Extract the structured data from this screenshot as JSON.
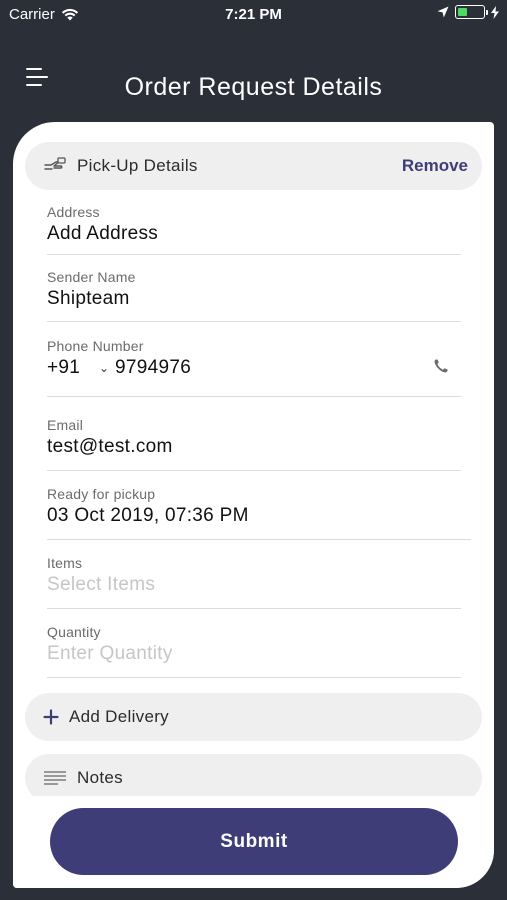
{
  "status_bar": {
    "carrier": "Carrier",
    "time": "7:21 PM"
  },
  "header": {
    "title": "Order Request Details"
  },
  "pickup": {
    "title": "Pick-Up Details",
    "remove_label": "Remove",
    "fields": {
      "address": {
        "label": "Address",
        "value": "Add Address"
      },
      "sender": {
        "label": "Sender Name",
        "value": "Shipteam"
      },
      "phone": {
        "label": "Phone Number",
        "code": "+91",
        "number": "9794976"
      },
      "email": {
        "label": "Email",
        "value": "test@test.com"
      },
      "ready": {
        "label": "Ready for pickup",
        "value": "03 Oct 2019, 07:36 PM"
      },
      "items": {
        "label": "Items",
        "placeholder": "Select Items"
      },
      "quantity": {
        "label": "Quantity",
        "placeholder": "Enter Quantity"
      }
    }
  },
  "add_delivery": {
    "label": "Add Delivery"
  },
  "notes": {
    "label": "Notes"
  },
  "submit": {
    "label": "Submit"
  },
  "colors": {
    "accent": "#3f3d78",
    "header_bg": "#2b2f38",
    "battery": "#4cd964"
  },
  "icons": {
    "wifi": "wifi-icon",
    "location": "location-arrow-icon",
    "battery": "battery-icon",
    "charging": "charging-bolt-icon",
    "menu": "hamburger-menu-icon",
    "pickup": "pickup-hand-icon",
    "phone": "phone-icon",
    "add": "plus-icon",
    "notes": "notes-lines-icon"
  }
}
